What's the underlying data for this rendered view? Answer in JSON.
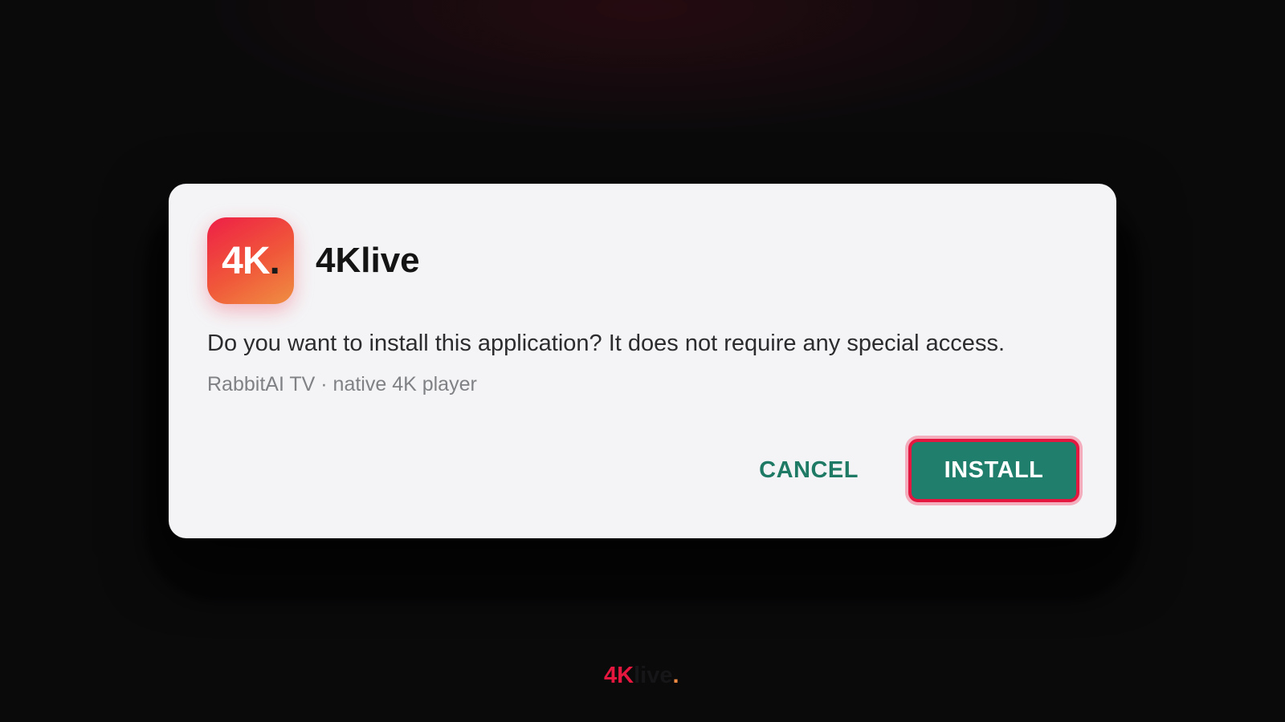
{
  "app": {
    "icon_text": "4K",
    "icon_dot": ".",
    "name": "4Klive"
  },
  "dialog": {
    "message": "Do you want to install this application? It does not require any special access.",
    "subtext": "RabbitAI TV · native 4K player",
    "cancel_label": "CANCEL",
    "install_label": "INSTALL"
  },
  "footer": {
    "brand_4k": "4K",
    "brand_live": "live",
    "brand_dot": "."
  },
  "colors": {
    "accent_green": "#1f7f6c",
    "focus_red": "#e3173f",
    "brand_orange": "#ef8f42"
  }
}
